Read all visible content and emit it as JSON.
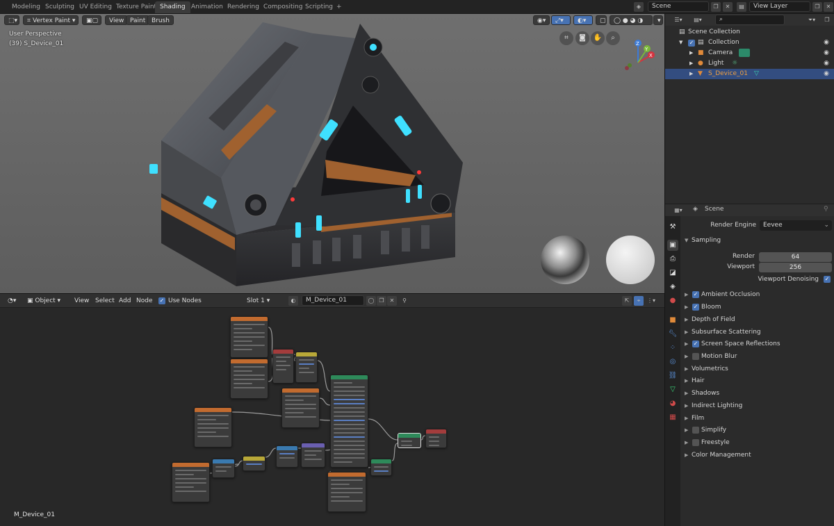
{
  "workspace_tabs": [
    "Modeling",
    "Sculpting",
    "UV Editing",
    "Texture Paint",
    "Shading",
    "Animation",
    "Rendering",
    "Compositing",
    "Scripting"
  ],
  "active_workspace": "Shading",
  "add_tab_symbol": "+",
  "scene_field": "Scene",
  "view_layer_field": "View Layer",
  "viewport": {
    "mode_label": "Vertex Paint",
    "menus": [
      "View",
      "Paint",
      "Brush"
    ],
    "overlay_title": "User Perspective",
    "overlay_object": "(39) S_Device_01",
    "gizmo_axes": [
      "X",
      "Y",
      "Z"
    ]
  },
  "node_editor": {
    "object_label": "Object",
    "menus": [
      "View",
      "Select",
      "Add",
      "Node"
    ],
    "use_nodes_label": "Use Nodes",
    "slot_label": "Slot 1",
    "material_name": "M_Device_01",
    "footer_material": "M_Device_01"
  },
  "outliner": {
    "root": "Scene Collection",
    "items": [
      {
        "label": "Collection",
        "level": 1
      },
      {
        "label": "Camera",
        "level": 2
      },
      {
        "label": "Light",
        "level": 2
      },
      {
        "label": "S_Device_01",
        "level": 2,
        "selected": true
      }
    ]
  },
  "properties": {
    "context": "Scene",
    "render_engine_label": "Render Engine",
    "render_engine_value": "Eevee",
    "sampling_label": "Sampling",
    "render_label": "Render",
    "render_value": "64",
    "viewport_label": "Viewport",
    "viewport_value": "256",
    "viewport_denoising_label": "Viewport Denoising",
    "panels": [
      {
        "label": "Ambient Occlusion",
        "checkbox": true
      },
      {
        "label": "Bloom",
        "checkbox": true
      },
      {
        "label": "Depth of Field",
        "checkbox": null
      },
      {
        "label": "Subsurface Scattering",
        "checkbox": null
      },
      {
        "label": "Screen Space Reflections",
        "checkbox": true
      },
      {
        "label": "Motion Blur",
        "checkbox": false
      },
      {
        "label": "Volumetrics",
        "checkbox": null
      },
      {
        "label": "Hair",
        "checkbox": null
      },
      {
        "label": "Shadows",
        "checkbox": null
      },
      {
        "label": "Indirect Lighting",
        "checkbox": null
      },
      {
        "label": "Film",
        "checkbox": null
      },
      {
        "label": "Simplify",
        "checkbox": false
      },
      {
        "label": "Freestyle",
        "checkbox": false
      },
      {
        "label": "Color Management",
        "checkbox": null
      }
    ]
  },
  "colors": {
    "accent_blue": "#4772b3",
    "selection_blue": "#334d80",
    "image_texture_header": "#c26b2f",
    "math_header": "#a33c3c",
    "vector_header": "#6a5fb0",
    "shader_header": "#2e8a5a",
    "converter_header": "#3a7ab0",
    "glow_cyan": "#3fe0ff"
  }
}
